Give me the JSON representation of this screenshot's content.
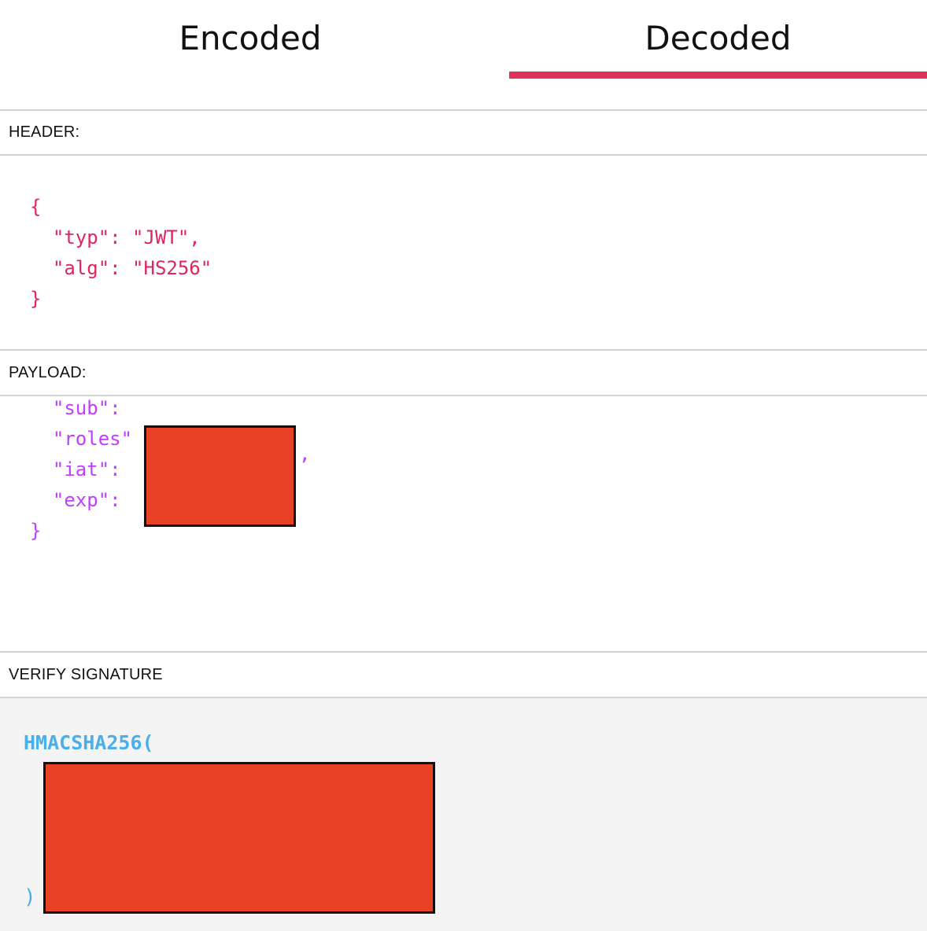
{
  "tabs": {
    "encoded": "Encoded",
    "decoded": "Decoded",
    "active": "decoded",
    "accent_color": "#e0335a"
  },
  "header": {
    "title": "HEADER:",
    "lines": [
      "{",
      "  \"typ\": \"JWT\",",
      "  \"alg\": \"HS256\"",
      "}"
    ],
    "color": "#e0245e"
  },
  "payload": {
    "title": "PAYLOAD:",
    "lines": [
      "  \"sub\": ",
      "  \"roles\"",
      "  \"iat\": ",
      "  \"exp\": ",
      "}"
    ],
    "comma": ",",
    "color": "#c13dff"
  },
  "verify": {
    "title": "VERIFY SIGNATURE",
    "func": "HMACSHA256(",
    "close": ")",
    "color": "#4aaee8"
  },
  "redaction_color": "#e84126"
}
